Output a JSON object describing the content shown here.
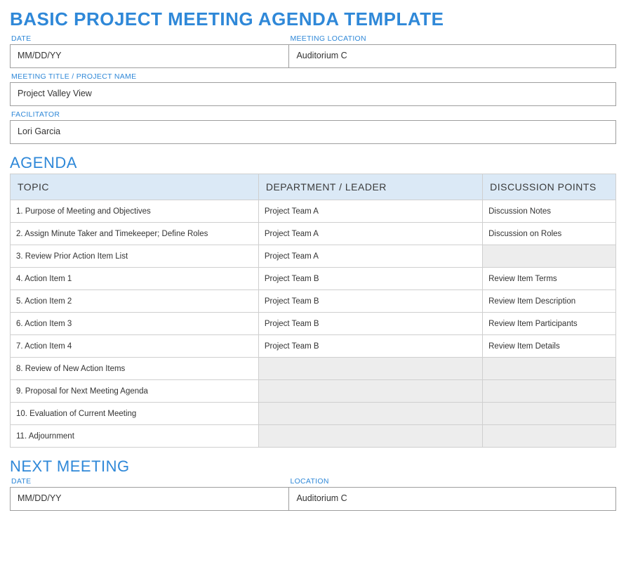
{
  "title": "BASIC PROJECT MEETING AGENDA TEMPLATE",
  "top": {
    "date_label": "DATE",
    "date_value": "MM/DD/YY",
    "location_label": "MEETING LOCATION",
    "location_value": "Auditorium C",
    "meeting_title_label": "MEETING TITLE / PROJECT NAME",
    "meeting_title_value": "Project Valley View",
    "facilitator_label": "FACILITATOR",
    "facilitator_value": "Lori Garcia"
  },
  "agenda": {
    "heading": "AGENDA",
    "columns": {
      "topic": "TOPIC",
      "department": "DEPARTMENT / LEADER",
      "discussion": "DISCUSSION POINTS"
    },
    "rows": [
      {
        "topic": "1. Purpose of Meeting and Objectives",
        "department": "Project Team A",
        "discussion": "Discussion Notes"
      },
      {
        "topic": "2. Assign Minute Taker and Timekeeper; Define Roles",
        "department": "Project Team A",
        "discussion": "Discussion on Roles"
      },
      {
        "topic": "3. Review Prior Action Item List",
        "department": "Project Team A",
        "discussion": ""
      },
      {
        "topic": "4. Action Item 1",
        "department": "Project Team B",
        "discussion": "Review Item Terms"
      },
      {
        "topic": "5. Action Item 2",
        "department": "Project Team B",
        "discussion": "Review Item Description"
      },
      {
        "topic": "6. Action Item 3",
        "department": "Project Team B",
        "discussion": "Review Item Participants"
      },
      {
        "topic": "7. Action Item 4",
        "department": "Project Team B",
        "discussion": "Review Item Details"
      },
      {
        "topic": "8. Review of New Action Items",
        "department": "",
        "discussion": ""
      },
      {
        "topic": "9. Proposal for Next Meeting Agenda",
        "department": "",
        "discussion": ""
      },
      {
        "topic": "10. Evaluation of Current Meeting",
        "department": "",
        "discussion": ""
      },
      {
        "topic": "11. Adjournment",
        "department": "",
        "discussion": ""
      }
    ]
  },
  "next": {
    "heading": "NEXT MEETING",
    "date_label": "DATE",
    "date_value": "MM/DD/YY",
    "location_label": "LOCATION",
    "location_value": "Auditorium C"
  }
}
